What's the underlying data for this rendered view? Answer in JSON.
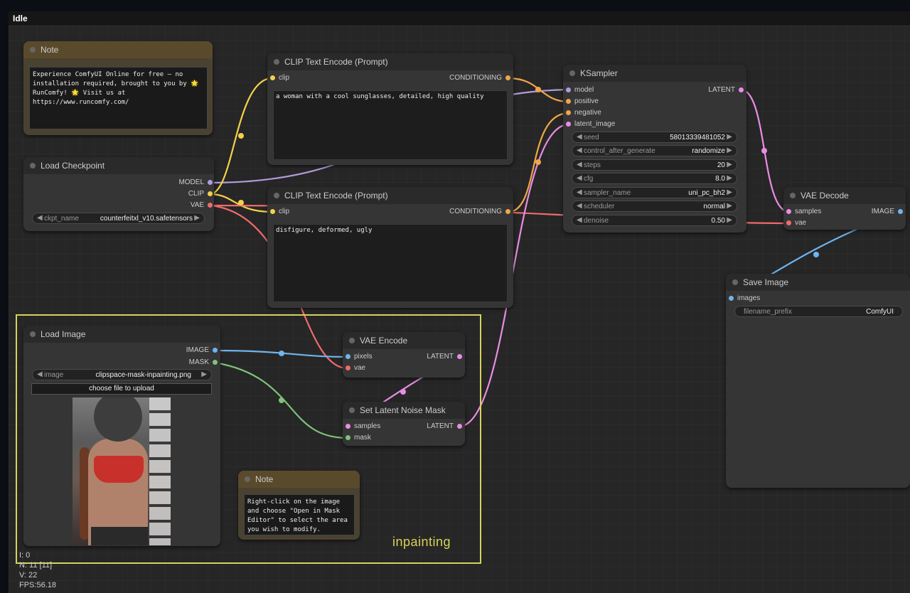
{
  "status": "Idle",
  "colors": {
    "model": "#b29bdc",
    "clip": "#f5d04b",
    "vae": "#f06b6b",
    "conditioning": "#f0a64a",
    "latent": "#e98de6",
    "image": "#6fb4ee",
    "mask": "#7fc27a",
    "group": "#d6d35a"
  },
  "notes": [
    {
      "title": "Note",
      "text": "Experience ComfyUI Online for free — no installation required, brought to you by 🌟 RunComfy! 🌟 Visit us at https://www.runcomfy.com/"
    },
    {
      "title": "Note",
      "text": "Right-click on the image and choose \"Open in Mask Editor\" to select the area you wish to modify."
    }
  ],
  "load_checkpoint": {
    "title": "Load Checkpoint",
    "outputs": [
      "MODEL",
      "CLIP",
      "VAE"
    ],
    "widget": {
      "name": "ckpt_name",
      "value": "counterfeitxl_v10.safetensors"
    }
  },
  "clip_pos": {
    "title": "CLIP Text Encode (Prompt)",
    "input": "clip",
    "output": "CONDITIONING",
    "text": "a woman with a cool sunglasses, detailed, high quality"
  },
  "clip_neg": {
    "title": "CLIP Text Encode (Prompt)",
    "input": "clip",
    "output": "CONDITIONING",
    "text": "disfigure, deformed, ugly"
  },
  "ksampler": {
    "title": "KSampler",
    "inputs": [
      "model",
      "positive",
      "negative",
      "latent_image"
    ],
    "output": "LATENT",
    "widgets": [
      {
        "name": "seed",
        "value": "58013339481052"
      },
      {
        "name": "control_after_generate",
        "value": "randomize"
      },
      {
        "name": "steps",
        "value": "20"
      },
      {
        "name": "cfg",
        "value": "8.0"
      },
      {
        "name": "sampler_name",
        "value": "uni_pc_bh2"
      },
      {
        "name": "scheduler",
        "value": "normal"
      },
      {
        "name": "denoise",
        "value": "0.50"
      }
    ]
  },
  "vae_decode": {
    "title": "VAE Decode",
    "inputs": [
      "samples",
      "vae"
    ],
    "output": "IMAGE"
  },
  "save_image": {
    "title": "Save Image",
    "input": "images",
    "widget": {
      "name": "filename_prefix",
      "value": "ComfyUI"
    }
  },
  "load_image": {
    "title": "Load Image",
    "outputs": [
      "IMAGE",
      "MASK"
    ],
    "widget": {
      "name": "image",
      "value": "clipspace-mask-inpainting.png"
    },
    "upload": "choose file to upload"
  },
  "vae_encode": {
    "title": "VAE Encode",
    "inputs": [
      "pixels",
      "vae"
    ],
    "output": "LATENT"
  },
  "set_latent": {
    "title": "Set Latent Noise Mask",
    "inputs": [
      "samples",
      "mask"
    ],
    "output": "LATENT"
  },
  "group_label": "inpainting",
  "stats": {
    "i": "I: 0",
    "n": "N: 11 [11]",
    "v": "V: 22",
    "fps": "FPS:56.18"
  }
}
